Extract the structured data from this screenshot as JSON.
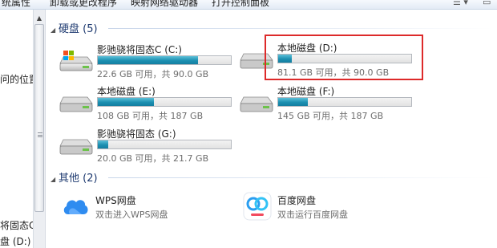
{
  "toolbar": {
    "items": [
      "统属性",
      "卸载或更改程序",
      "映射网络驱动器",
      "打开控制面板"
    ],
    "view_icon": "view-options-icon"
  },
  "nav": {
    "items": [
      "问的位置",
      "将固态C (",
      "盘 (D:)"
    ]
  },
  "sections": {
    "hard_disks": {
      "label": "硬盘 (5)"
    },
    "other": {
      "label": "其他 (2)"
    }
  },
  "drives": [
    {
      "name": "影驰骁将固态C (C:)",
      "info": "22.6 GB 可用，共 90.0 GB",
      "used_fraction": 0.75,
      "icon": "windows-drive-icon"
    },
    {
      "name": "本地磁盘 (D:)",
      "info": "81.1 GB 可用，共 90.0 GB",
      "used_fraction": 0.1,
      "icon": "hard-drive-icon"
    },
    {
      "name": "本地磁盘 (E:)",
      "info": "108 GB 可用，共 187 GB",
      "used_fraction": 0.42,
      "icon": "hard-drive-icon"
    },
    {
      "name": "本地磁盘 (F:)",
      "info": "145 GB 可用，共 187 GB",
      "used_fraction": 0.22,
      "icon": "hard-drive-icon"
    },
    {
      "name": "影驰骁将固态 (G:)",
      "info": "20.0 GB 可用，共 21.7 GB",
      "used_fraction": 0.08,
      "icon": "hard-drive-icon"
    }
  ],
  "apps": [
    {
      "name": "WPS网盘",
      "desc": "双击进入WPS网盘",
      "icon": "wps-cloud-icon",
      "color": "#2f8cf0"
    },
    {
      "name": "百度网盘",
      "desc": "双击运行百度网盘",
      "icon": "baidu-netdisk-icon",
      "color": "#2a9ef0"
    }
  ],
  "colors": {
    "bar_fill": "#1c8fb1",
    "highlight": "#dd2a2a",
    "section_text": "#1e3a70"
  }
}
